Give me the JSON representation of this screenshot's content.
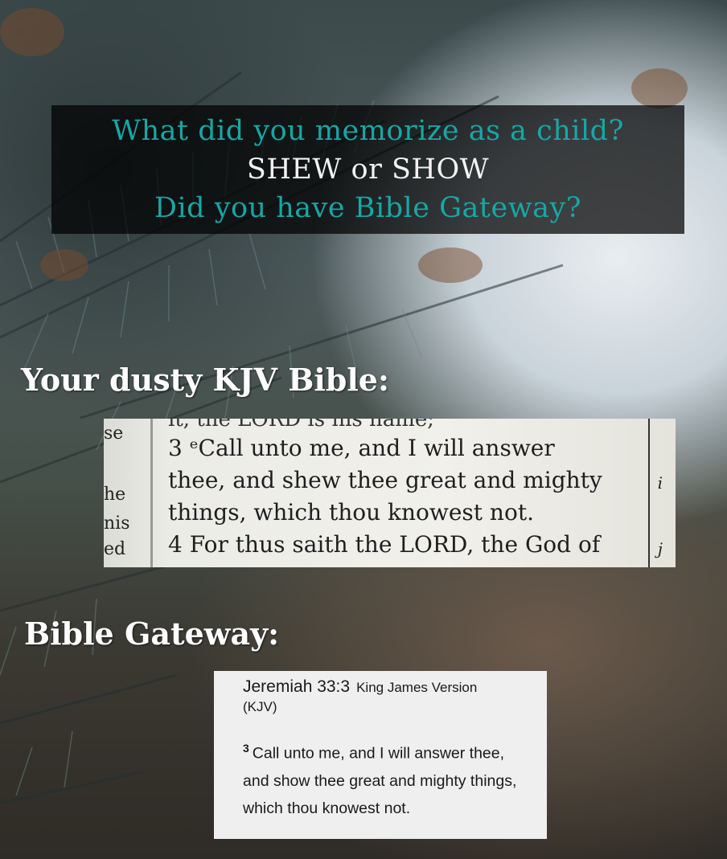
{
  "title": {
    "line1": "What did you memorize as a child?",
    "line2": "SHEW or SHOW",
    "line3": "Did you have Bible Gateway?"
  },
  "labels": {
    "kjv": "Your dusty KJV Bible:",
    "gateway": "Bible Gateway:"
  },
  "page_photo": {
    "cut_top": "it, the LORD is his name;",
    "margin_fragments": [
      "se",
      "he",
      "nis",
      "ed"
    ],
    "lines": [
      "3 ᵉCall unto me, and I will answer",
      "thee, and shew thee great and mighty",
      "things, which thou knowest not.",
      "4 For thus saith the LORD, the God of"
    ],
    "right_marks": [
      "i",
      "j"
    ]
  },
  "gateway": {
    "reference": "Jeremiah 33:3",
    "version": "King James Version",
    "version_abbr": "(KJV)",
    "verse_number": "3",
    "verse_text": "Call unto me, and I will answer thee, and show thee great and mighty things, which thou knowest not."
  },
  "colors": {
    "accent_teal": "#19a6a6",
    "overlay": "#000000",
    "card_bg": "#efefef"
  }
}
